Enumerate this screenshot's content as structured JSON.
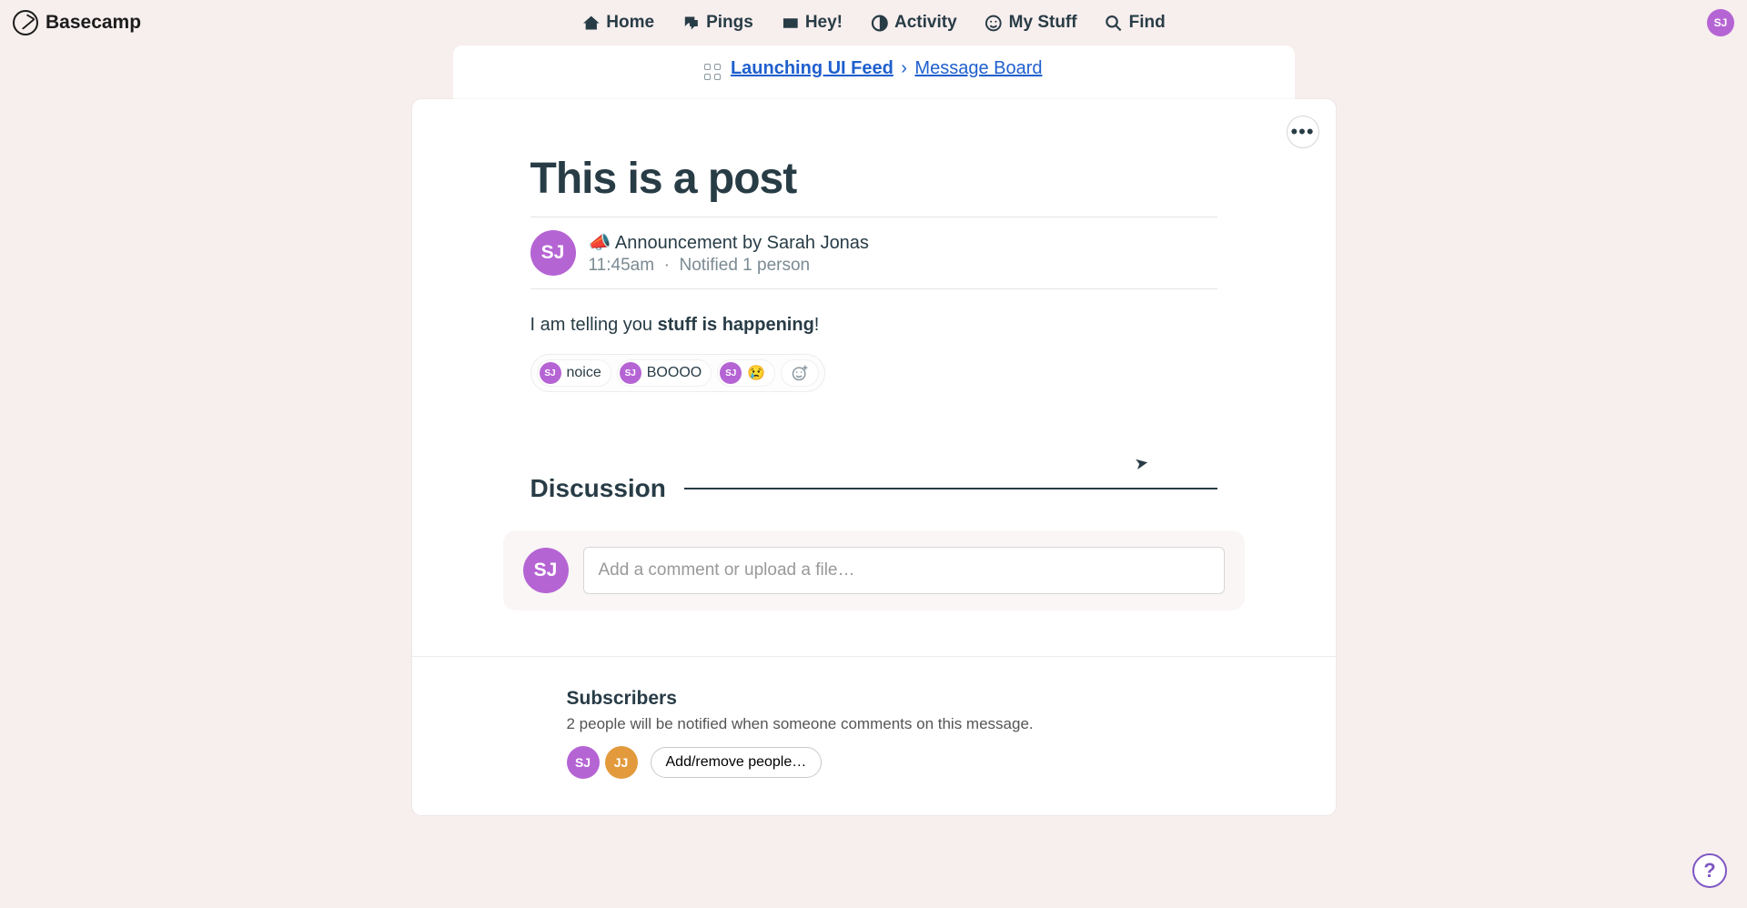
{
  "brand": "Basecamp",
  "user": {
    "initials": "SJ"
  },
  "nav": {
    "home": "Home",
    "pings": "Pings",
    "hey": "Hey!",
    "activity": "Activity",
    "mystuff": "My Stuff",
    "find": "Find"
  },
  "breadcrumb": {
    "project": "Launching UI Feed",
    "separator": "›",
    "tool": "Message Board"
  },
  "post": {
    "title": "This is a post",
    "author_initials": "SJ",
    "category_emoji": "📣",
    "byline": "Announcement by Sarah Jonas",
    "time": "11:45am",
    "dot": "·",
    "notified": "Notified 1 person",
    "body_prefix": "I am telling you ",
    "body_bold": "stuff is happening",
    "body_suffix": "!"
  },
  "reactions": [
    {
      "initials": "SJ",
      "text": "noice"
    },
    {
      "initials": "SJ",
      "text": "BOOOO"
    },
    {
      "initials": "SJ",
      "text": "😢"
    }
  ],
  "discussion": {
    "heading": "Discussion",
    "commenter_initials": "SJ",
    "placeholder": "Add a comment or upload a file…"
  },
  "subscribers": {
    "heading": "Subscribers",
    "desc": "2 people will be notified when someone comments on this message.",
    "people": [
      {
        "initials": "SJ",
        "color": "purple"
      },
      {
        "initials": "JJ",
        "color": "orange"
      }
    ],
    "button": "Add/remove people…"
  },
  "help": "?"
}
